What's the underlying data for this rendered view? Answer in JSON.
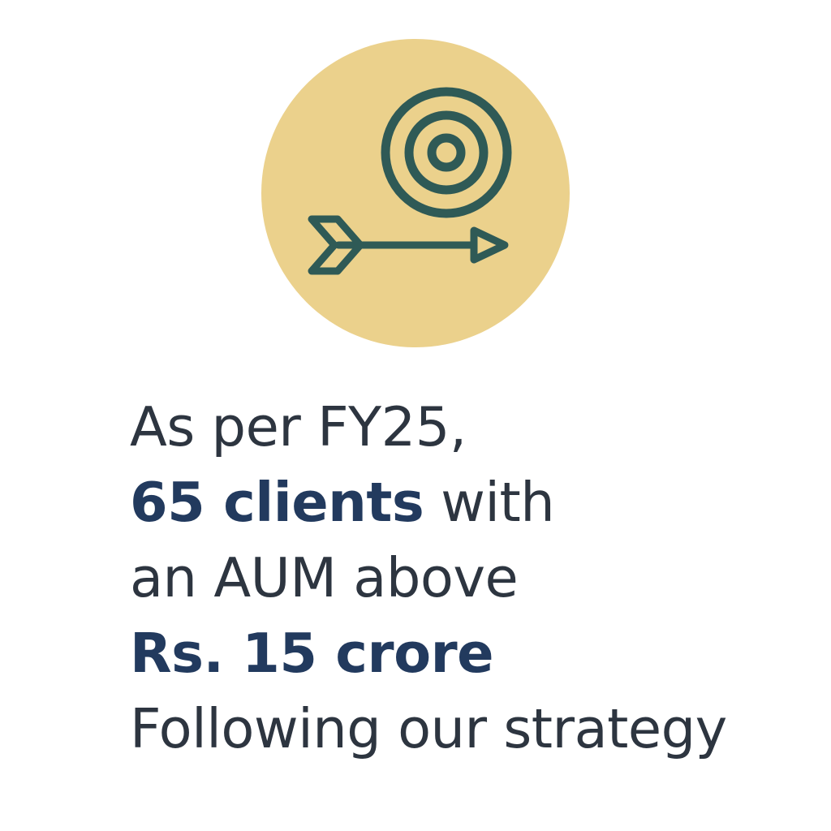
{
  "icon": {
    "name": "target-arrow-icon",
    "circle_color": "#ebd18c",
    "stroke_color": "#2f5a56"
  },
  "text": {
    "line1": "As per FY25,",
    "line2_bold": "65 clients",
    "line2_rest": " with",
    "line3": "an AUM above",
    "line4_bold": "Rs. 15 crore",
    "line5": "Following our strategy"
  },
  "colors": {
    "text": "#2d3540",
    "emphasis": "#223a5e"
  }
}
